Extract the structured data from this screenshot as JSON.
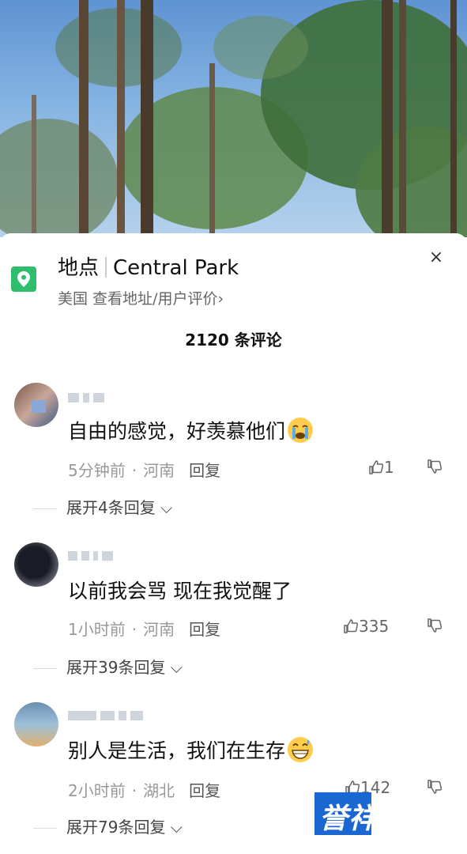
{
  "location": {
    "label": "地点",
    "name": "Central Park",
    "subtitle": "美国  查看地址/用户评价›",
    "close": "×"
  },
  "comment_count": "2120 条评论",
  "comments": [
    {
      "text": "自由的感觉，好羡慕他们",
      "emoji": "crying-face",
      "time": "5分钟前",
      "region": "河南",
      "reply": "回复",
      "likes": "1",
      "expand": "展开4条回复"
    },
    {
      "text": "以前我会骂 现在我觉醒了",
      "emoji": "",
      "time": "1小时前",
      "region": "河南",
      "reply": "回复",
      "likes": "335",
      "expand": "展开39条回复"
    },
    {
      "text": "别人是生活，我们在生存",
      "emoji": "grinning-sweat-face",
      "time": "2小时前",
      "region": "湖北",
      "reply": "回复",
      "likes": "142",
      "expand": "展开79条回复"
    }
  ],
  "watermark": "誉祥祥知识",
  "colors": {
    "location_icon": "#2fbd6e",
    "watermark": "#1a67d2"
  }
}
